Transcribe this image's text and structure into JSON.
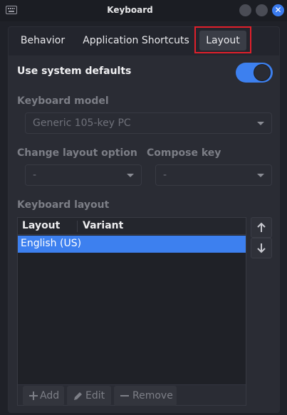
{
  "window": {
    "title": "Keyboard",
    "icon": "keyboard-icon",
    "close_glyph": "✕"
  },
  "tabs": [
    {
      "label": "Behavior",
      "selected": false
    },
    {
      "label": "Application Shortcuts",
      "selected": false
    },
    {
      "label": "Layout",
      "selected": true
    }
  ],
  "layout": {
    "use_system_defaults_label": "Use system defaults",
    "use_system_defaults_on": true,
    "keyboard_model_label": "Keyboard model",
    "keyboard_model_value": "Generic 105-key PC",
    "change_layout_option_label": "Change layout option",
    "change_layout_option_value": "-",
    "compose_key_label": "Compose key",
    "compose_key_value": "-",
    "keyboard_layout_label": "Keyboard layout",
    "columns": [
      "Layout",
      "Variant"
    ],
    "rows": [
      {
        "layout": "English (US)",
        "variant": "",
        "selected": true
      }
    ],
    "buttons": {
      "add": "Add",
      "edit": "Edit",
      "remove": "Remove"
    }
  },
  "colors": {
    "accent": "#3d80ef",
    "highlight": "#e0202b",
    "background": "#2a2c34"
  }
}
